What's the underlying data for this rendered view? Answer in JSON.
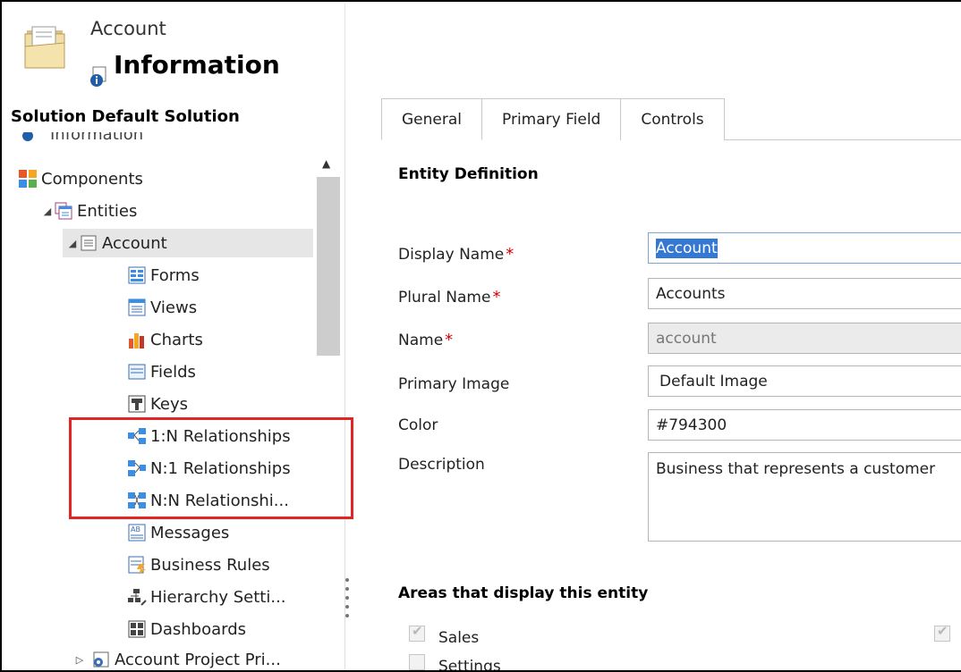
{
  "header": {
    "entity_name": "Account",
    "title": "Information"
  },
  "nav": {
    "solution_label": "Solution Default Solution",
    "cut_item": "Information",
    "items": [
      {
        "label": "Components"
      },
      {
        "label": "Entities"
      },
      {
        "label": "Account"
      },
      {
        "label": "Forms"
      },
      {
        "label": "Views"
      },
      {
        "label": "Charts"
      },
      {
        "label": "Fields"
      },
      {
        "label": "Keys"
      },
      {
        "label": "1:N Relationships"
      },
      {
        "label": "N:1 Relationships"
      },
      {
        "label": "N:N Relationshi..."
      },
      {
        "label": "Messages"
      },
      {
        "label": "Business Rules"
      },
      {
        "label": "Hierarchy Setti..."
      },
      {
        "label": "Dashboards"
      },
      {
        "label": "Account Project Pri..."
      }
    ]
  },
  "tabs": [
    {
      "label": "General"
    },
    {
      "label": "Primary Field"
    },
    {
      "label": "Controls"
    }
  ],
  "form": {
    "section_title": "Entity Definition",
    "required_mark": "*",
    "fields": {
      "display_name": {
        "label": "Display Name",
        "value": "Account"
      },
      "plural_name": {
        "label": "Plural Name",
        "value": "Accounts"
      },
      "name": {
        "label": "Name",
        "value": "account"
      },
      "primary_image": {
        "label": "Primary Image",
        "value": "Default Image"
      },
      "color": {
        "label": "Color",
        "value": "#794300"
      },
      "description": {
        "label": "Description",
        "value": "Business that represents a customer"
      }
    },
    "areas_title": "Areas that display this entity",
    "areas": [
      {
        "label": "Sales",
        "checked": true
      },
      {
        "label": "Settings",
        "checked": false
      }
    ]
  },
  "colors": {
    "highlight_box": "#e32424",
    "selection": "#3478d4",
    "required": "#d50000"
  }
}
